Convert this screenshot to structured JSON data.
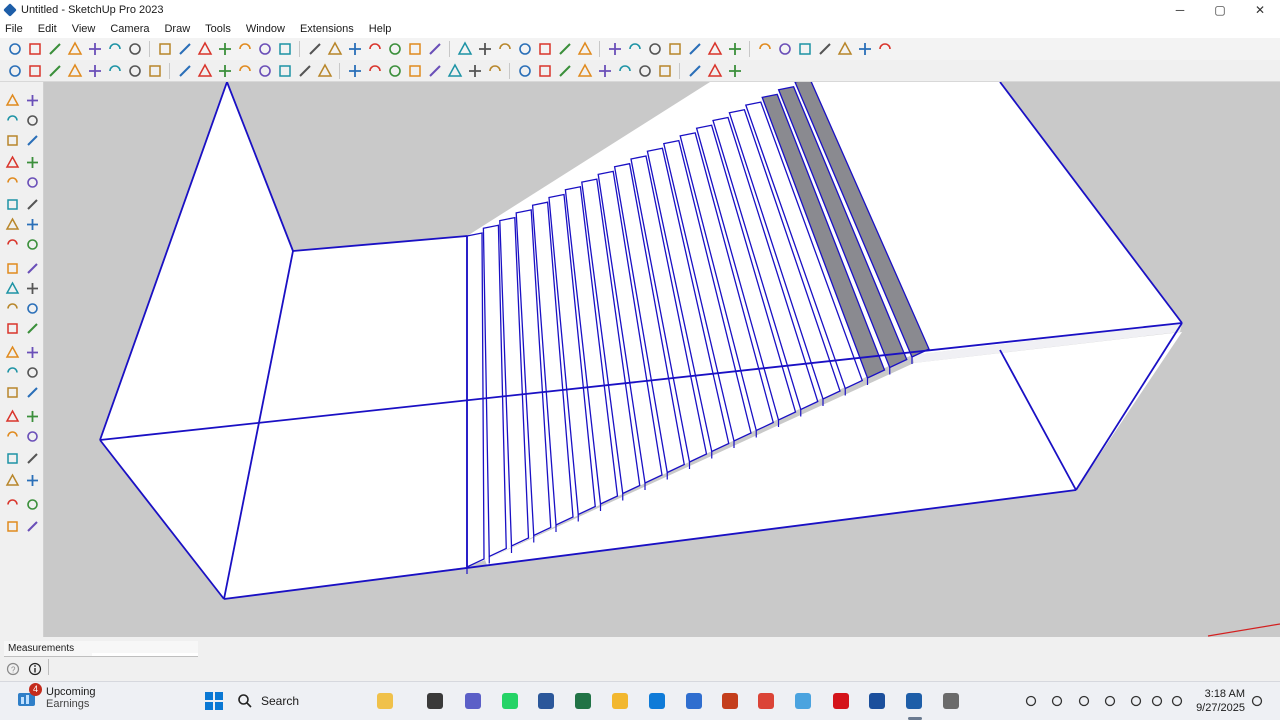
{
  "window": {
    "title": "Untitled - SketchUp Pro 2023",
    "controls": {
      "minimize": "─",
      "maximize": "▢",
      "close": "✕"
    }
  },
  "menu": {
    "items": [
      "File",
      "Edit",
      "View",
      "Camera",
      "Draw",
      "Tools",
      "Window",
      "Extensions",
      "Help"
    ]
  },
  "toolbar_top": {
    "icons": [
      "select-icon",
      "eraser-icon",
      "pencil-icon",
      "arc-icon",
      "rectangle-icon",
      "push-pull-icon",
      "follow-me-icon",
      "move-icon",
      "rotate-icon",
      "scale-icon",
      "offset-icon",
      "tape-measure-icon",
      "dimension-icon",
      "protractor-icon",
      "text-icon",
      "axes-icon",
      "3d-text-icon",
      "section-plane-icon",
      "orbit-icon",
      "open-folder-icon",
      "settings-gear-icon",
      "close-circle-icon",
      "component-icon",
      "xray-icon",
      "back-edges-icon",
      "wireframe-icon",
      "hidden-line-icon",
      "shaded-icon",
      "textured-icon",
      "monochrome-icon",
      "warehouse-icon",
      "extension-icon",
      "cloud-icon",
      "sandbox-icon",
      "view-iso-icon",
      "view-top-icon",
      "view-front-icon",
      "view-right-icon",
      "view-back-icon",
      "view-left-icon",
      "style-icon",
      "solid-tools-icon"
    ]
  },
  "toolbar_second": {
    "icons": [
      "sandbox-from-contours-icon",
      "from-scratch-icon",
      "smoove-icon",
      "stamp-icon",
      "drape-icon",
      "add-detail-icon",
      "flip-edge-icon",
      "outer-shell-icon",
      "intersect-icon",
      "union-icon",
      "subtract-icon",
      "trim-icon",
      "split-icon",
      "section-fill-icon",
      "display-section-icon",
      "display-cuts-icon",
      "camera-position-icon",
      "look-around-icon",
      "walk-icon",
      "layers-icon",
      "tags-icon",
      "materials-icon",
      "scenes-icon",
      "shadows-icon",
      "fog-icon",
      "match-photo-icon",
      "soften-edges-icon",
      "instructor-icon",
      "outliner-icon",
      "entity-info-icon",
      "add-location-icon",
      "toggle-terrain-icon",
      "preview-icon",
      "share-model-icon",
      "account-icon"
    ]
  },
  "left_toolbar": {
    "icons": [
      "select-tool-icon",
      "lasso-icon",
      "paint-bucket-icon",
      "eraser-tool-icon",
      "line-tool-icon",
      "freehand-icon",
      "rectangle-tool-icon",
      "rotated-rectangle-icon",
      "circle-tool-icon",
      "polygon-tool-icon",
      "arc-tool-icon",
      "two-point-arc-icon",
      "pie-icon",
      "three-point-arc-icon",
      "move-tool-icon",
      "push-pull-tool-icon",
      "rotate-tool-icon",
      "follow-me-tool-icon",
      "scale-tool-icon",
      "offset-tool-icon",
      "tape-tool-icon",
      "protractor-tool-icon",
      "dimension-tool-icon",
      "text-tool-icon",
      "axes-tool-icon",
      "3d-text-tool-icon",
      "section-tool-icon",
      "section-fill-tool-icon",
      "orbit-tool-icon",
      "pan-tool-icon",
      "zoom-tool-icon",
      "zoom-window-icon",
      "zoom-extents-icon",
      "previous-view-icon",
      "position-camera-icon",
      "walk-tool-icon",
      "look-around-tool-icon",
      "section-display-icon",
      "components-tool-icon",
      "sandbox-tool-icon",
      "layers-tool-icon",
      "styles-tool-icon"
    ]
  },
  "status": {
    "measurements_label": "Measurements",
    "measurements_value": ""
  },
  "taskbar": {
    "weather_badge": "4",
    "weather_line1": "Upcoming",
    "weather_line2": "Earnings",
    "search_label": "Search",
    "time": "3:18 AM",
    "date": "9/27/2025",
    "apps": [
      "windows-start-icon",
      "search-icon",
      "widgets-icon",
      "file-explorer-icon",
      "teams-icon",
      "whatsapp-icon",
      "word-icon",
      "excel-icon",
      "folder-icon",
      "edge-icon",
      "store-icon",
      "powerpoint-icon",
      "chrome-icon",
      "flight-icon",
      "acrobat-icon",
      "trimble-icon",
      "sketchup-icon",
      "layout-icon"
    ],
    "tray": [
      "chevron-up-icon",
      "cloud-sync-icon",
      "sync-icon",
      "mic-icon",
      "wifi-icon",
      "volume-icon",
      "battery-icon",
      "notification-bell-icon"
    ]
  },
  "colors": {
    "viewport_bg": "#c9c9c9",
    "edge_blue": "#1a10c4",
    "face_white": "#ffffff",
    "face_shadow": "#7d7d80",
    "axis_red": "#d32020",
    "taskbar_bg": "#eef0f4"
  }
}
